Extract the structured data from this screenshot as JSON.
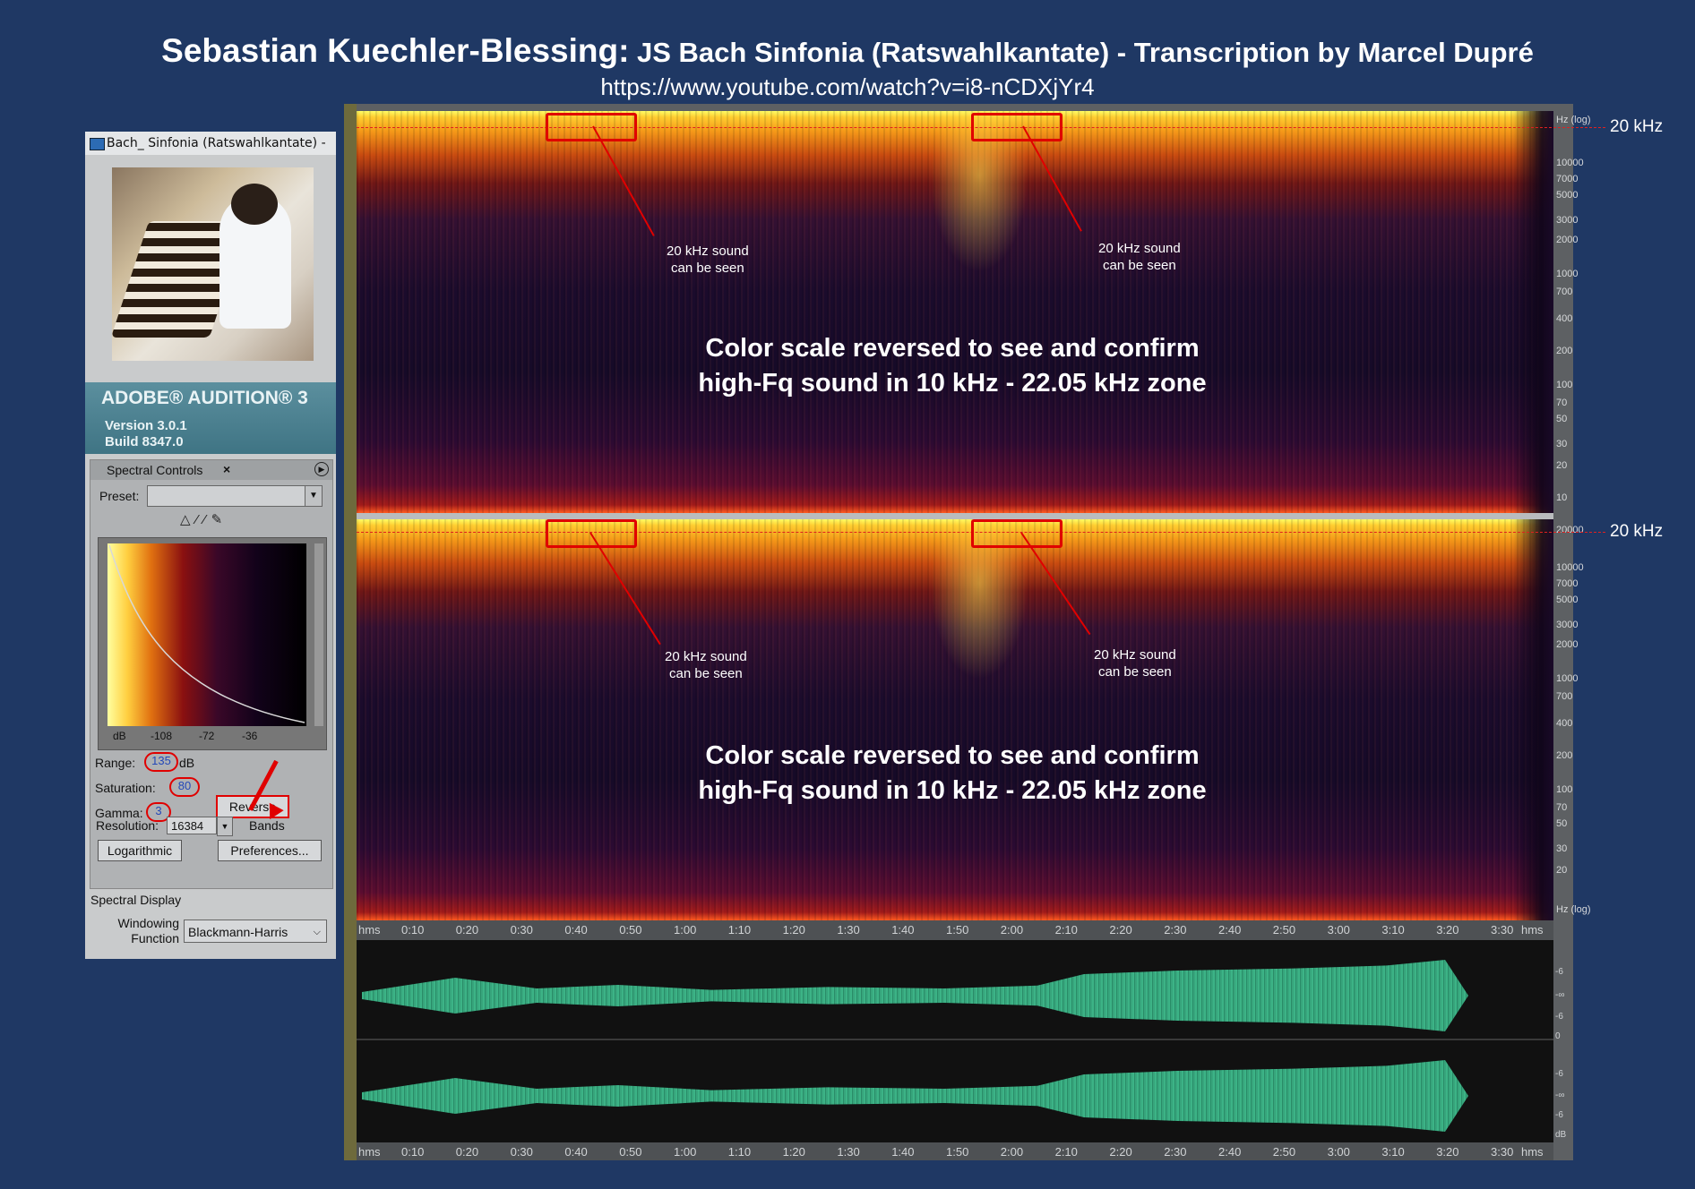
{
  "header": {
    "title_main": "Sebastian Kuechler-Blessing:",
    "title_rest": " JS Bach Sinfonia  (Ratswahlkantate) - Transcription by Marcel Dupré",
    "url": "https://www.youtube.com/watch?v=i8-nCDXjYr4"
  },
  "colors": {
    "background": "#1f3864",
    "annotation_red": "#e00000",
    "waveform_green": "#3cb386"
  },
  "left_panel": {
    "file_title": "Bach_ Sinfonia (Ratswahlkantate) -",
    "app_name": "ADOBE® AUDITION® 3",
    "version": "Version 3.0.1",
    "build": "Build 8347.0",
    "spectral_controls": {
      "tab_label": "Spectral Controls",
      "close": "×",
      "preset_label": "Preset:",
      "preset_value": "",
      "db_ticks": [
        "dB",
        "-108",
        "-72",
        "-36"
      ],
      "range_label": "Range:",
      "range_value": "135",
      "range_unit": "dB",
      "saturation_label": "Saturation:",
      "saturation_value": "80",
      "gamma_label": "Gamma:",
      "gamma_value": "3",
      "reverse_button": "Reverse",
      "resolution_label": "Resolution:",
      "resolution_value": "16384",
      "bands_label": "Bands",
      "logarithmic_button": "Logarithmic",
      "preferences_button": "Preferences..."
    },
    "spectral_display": {
      "title": "Spectral Display",
      "windowing_label_1": "Windowing",
      "windowing_label_2": "Function",
      "windowing_value": "Blackmann-Harris"
    }
  },
  "spectrogram": {
    "freq_axis_top": [
      "Hz (log)",
      "10000",
      "7000",
      "5000",
      "3000",
      "2000",
      "1000",
      "700",
      "400",
      "200",
      "100",
      "70",
      "50",
      "30",
      "20",
      "10"
    ],
    "freq_axis_bottom": [
      "20000",
      "10000",
      "7000",
      "5000",
      "3000",
      "2000",
      "1000",
      "700",
      "400",
      "200",
      "100",
      "70",
      "50",
      "30",
      "20",
      "Hz (log)"
    ],
    "khz_label": "20 kHz",
    "annotation_line1": "20 kHz sound",
    "annotation_line2": "can be seen",
    "big_text_line1": "Color scale reversed to see and confirm",
    "big_text_line2": "high-Fq sound in 10 kHz - 22.05 kHz zone"
  },
  "timeline": {
    "labels": [
      "hms",
      "0:10",
      "0:20",
      "0:30",
      "0:40",
      "0:50",
      "1:00",
      "1:10",
      "1:20",
      "1:30",
      "1:40",
      "1:50",
      "2:00",
      "2:10",
      "2:20",
      "2:30",
      "2:40",
      "2:50",
      "3:00",
      "3:10",
      "3:20",
      "3:30",
      "hms"
    ]
  },
  "waveform_db_axis": [
    "-6",
    "-∞",
    "-6",
    "0",
    "-6",
    "-∞",
    "-6",
    "dB"
  ]
}
